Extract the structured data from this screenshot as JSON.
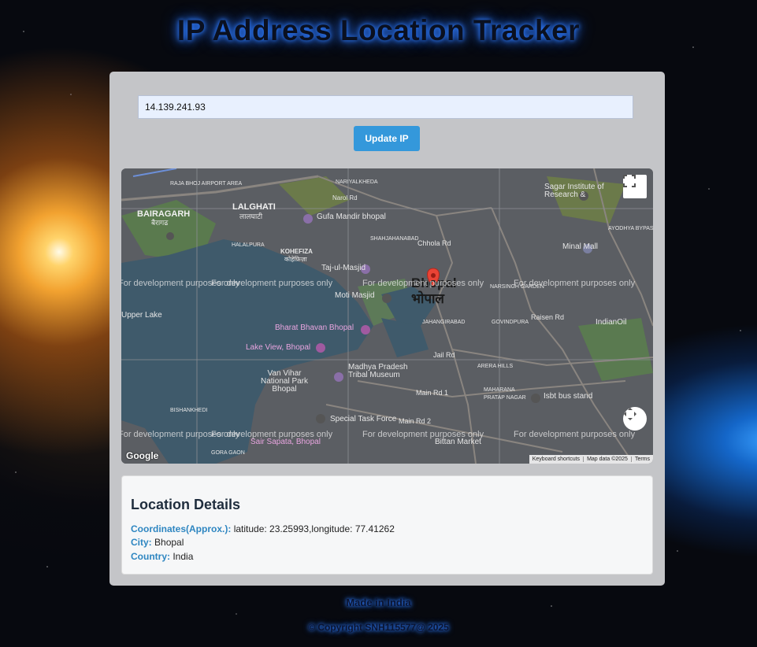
{
  "app": {
    "title": "IP Address Location Tracker"
  },
  "form": {
    "ip_value": "14.139.241.93",
    "update_label": "Update IP"
  },
  "map": {
    "city_en": "Bhopal",
    "city_hi": "भोपाल",
    "watermark": "For development purposes only",
    "labels": {
      "raja_bhoj_airport": "RAJA BHOJ AIRPORT AREA",
      "bairagarh": "BAIRAGARH",
      "bairagarh_hi": "बैरागढ",
      "lalghati": "LALGHATI",
      "lalghati_hi": "लालघाटी",
      "halalpura": "HALALPURA",
      "kohefiza": "KOHEFIZA",
      "kohefiza_hi": "कोहेफ़िज़ा",
      "gufa_mandir": "Gufa Mandir bhopal",
      "taj_ul_masjid": "Taj-ul-Masjid",
      "moti_masjid": "Moti Masjid",
      "upper_lake": "Upper Lake",
      "bharat_bhavan": "Bharat Bhavan Bhopal",
      "lake_view": "Lake View, Bhopal",
      "van_vihar": "Van Vihar National Park Bhopal",
      "madhya_pradesh_museum": "Madhya Pradesh Tribal Museum",
      "special_task_force": "Special Task Force",
      "bittan_market": "Bittan Market",
      "sair_sapata": "Sair Sapata, Bhopal",
      "sagar_institute": "Sagar Institute of Research &",
      "minal_mall": "Minal Mall",
      "ayodhya_bypass": "AYODHYA BYPASS",
      "indianoil": "IndianOil",
      "isbt": "Isbt bus stand",
      "shahjahanabad": "SHAHJAHANABAD",
      "jahangirabad": "JAHANGIRABAD",
      "govindpura": "GOVINDPURA",
      "arera_hills": "ARERA HILLS",
      "maharana_pratap_nagar": "MAHARANA PRATAP NAGAR",
      "bishankhedi": "BISHANKHEDI",
      "gora_gaon": "GORA GAON",
      "narsingh_garden": "NARSINGH GARDEN",
      "nariyalkheda": "NARIYALKHEDA",
      "raisen_rd": "Raisen Rd",
      "jail_rd": "Jail Rd",
      "main_rd1": "Main Rd 1",
      "main_rd2": "Main Rd 2",
      "chhola_rd": "Chhola Rd",
      "narol_rd": "Narol Rd"
    },
    "google": "Google",
    "attrib_shortcuts": "Keyboard shortcuts",
    "attrib_data": "Map data ©2025",
    "attrib_terms": "Terms"
  },
  "details": {
    "heading": "Location Details",
    "coords_label": "Coordinates(Approx.):",
    "coords_value": "latitude: 23.25993,longitude: 77.41262",
    "city_label": "City:",
    "city_value": "Bhopal",
    "country_label": "Country:",
    "country_value": "India"
  },
  "footer": {
    "made_in": "Made in India",
    "copyright": "© Copyright SNH115577@ 2025"
  },
  "colors": {
    "button": "#3498db",
    "key_text": "#2e86c1",
    "title_glow": "#2f7cff"
  }
}
